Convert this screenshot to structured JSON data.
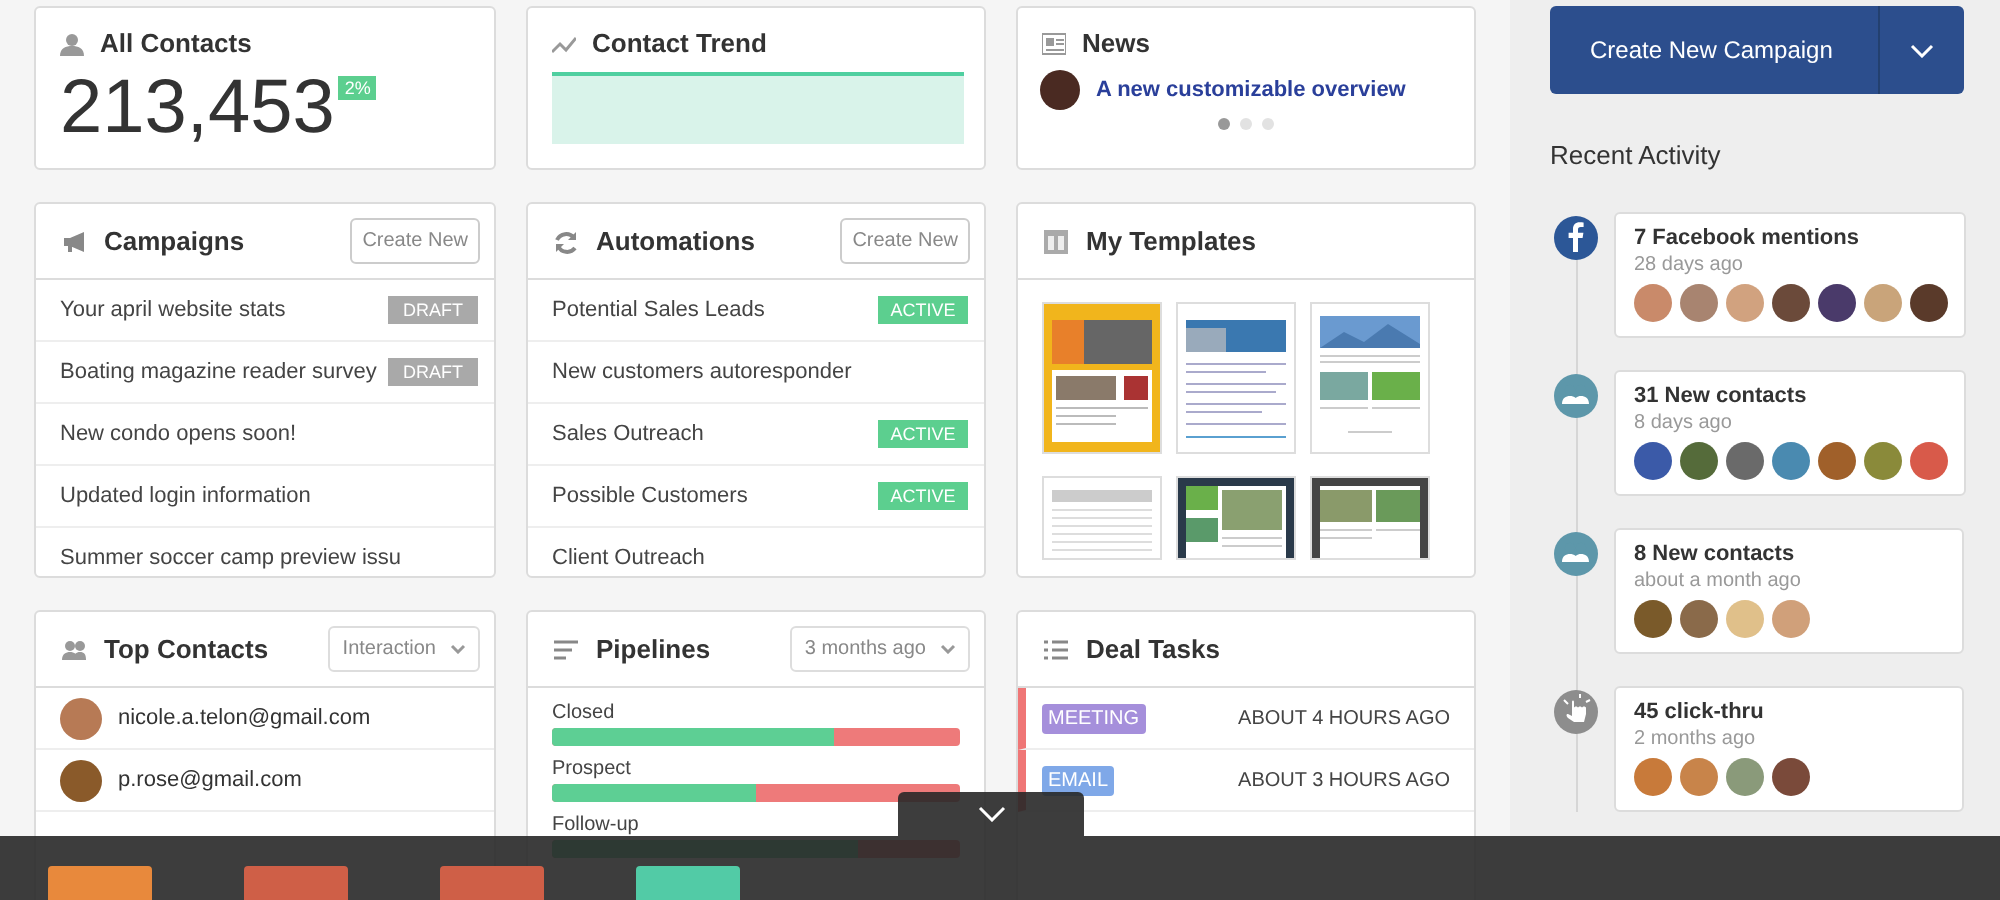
{
  "summary": {
    "title": "All Contacts",
    "count": "213,453",
    "change": "2%"
  },
  "trend": {
    "title": "Contact Trend"
  },
  "news": {
    "title": "News",
    "headline": "A new customizable overview",
    "pages": [
      {
        "selected": true
      },
      {
        "selected": false
      },
      {
        "selected": false
      }
    ]
  },
  "campaigns": {
    "title": "Campaigns",
    "action": "Create New",
    "rows": [
      {
        "name": "Your april website stats",
        "status": "DRAFT"
      },
      {
        "name": "Boating magazine reader survey",
        "status": "DRAFT"
      },
      {
        "name": "New condo opens soon!"
      },
      {
        "name": "Updated login information"
      },
      {
        "name": "Summer soccer camp preview issu"
      }
    ]
  },
  "automations": {
    "title": "Automations",
    "action": "Create New",
    "rows": [
      {
        "name": "Potential Sales Leads",
        "status": "ACTIVE"
      },
      {
        "name": "New customers autoresponder"
      },
      {
        "name": "Sales Outreach",
        "status": "ACTIVE"
      },
      {
        "name": "Possible Customers",
        "status": "ACTIVE"
      },
      {
        "name": "Client Outreach"
      }
    ]
  },
  "templates": {
    "title": "My Templates",
    "items": [
      {
        "kind": "promo"
      },
      {
        "kind": "newsletter"
      },
      {
        "kind": "landscape"
      },
      {
        "kind": "text"
      },
      {
        "kind": "dark"
      },
      {
        "kind": "grey"
      }
    ]
  },
  "top_contacts": {
    "title": "Top Contacts",
    "filter": "Interaction",
    "rows": [
      {
        "email": "nicole.a.telon@gmail.com",
        "color": "#b77a55"
      },
      {
        "email": "p.rose@gmail.com",
        "color": "#8a5a2a"
      }
    ]
  },
  "pipelines": {
    "title": "Pipelines",
    "filter": "3 months ago",
    "stages": [
      {
        "name": "Closed",
        "level": 0.69
      },
      {
        "name": "Prospect",
        "level": 0.5
      },
      {
        "name": "Follow-up",
        "level": 0.75
      }
    ]
  },
  "deal_tasks": {
    "title": "Deal Tasks",
    "rows": [
      {
        "type": "MEETING",
        "color": "#a58fdb",
        "time": "ABOUT 4 HOURS AGO"
      },
      {
        "type": "EMAIL",
        "color": "#7fa8e8",
        "time": "ABOUT 3 HOURS AGO"
      }
    ]
  },
  "sidebar": {
    "primary_button": "Create New Campaign",
    "heading": "Recent Activity",
    "activity": [
      {
        "kind": "facebook",
        "title": "7 Facebook mentions",
        "time": "28 days ago",
        "avatars": [
          {
            "color": "#c98a6a"
          },
          {
            "color": "#a88470"
          },
          {
            "color": "#d1a27f"
          },
          {
            "color": "#6b4a3a"
          },
          {
            "color": "#4a3a6a"
          },
          {
            "color": "#c9a47a"
          },
          {
            "color": "#5a3a2a"
          }
        ]
      },
      {
        "kind": "contacts",
        "title": "31 New contacts",
        "time": "8 days ago",
        "avatars": [
          {
            "color": "#3b5aa8"
          },
          {
            "color": "#556b3a"
          },
          {
            "color": "#6a6a6a"
          },
          {
            "color": "#4a8ab0"
          },
          {
            "color": "#a0602a"
          },
          {
            "color": "#8a8a3a"
          },
          {
            "color": "#d85a4a"
          }
        ]
      },
      {
        "kind": "contacts",
        "title": "8 New contacts",
        "time": "about a month ago",
        "avatars": [
          {
            "color": "#7a5a2a"
          },
          {
            "color": "#8a6a4a"
          },
          {
            "color": "#e0c08a"
          },
          {
            "color": "#d0a07a"
          }
        ]
      },
      {
        "kind": "click",
        "title": "45 click-thru",
        "time": "2 months ago",
        "avatars": [
          {
            "color": "#c87a3a"
          },
          {
            "color": "#c8844a"
          },
          {
            "color": "#8a9a7a"
          },
          {
            "color": "#7a4a3a"
          }
        ]
      }
    ]
  },
  "dock": {
    "tiles": [
      {
        "color": "#e8893c"
      },
      {
        "color": "#cf5f47"
      },
      {
        "color": "#cf5f47"
      },
      {
        "color": "#52cba6"
      }
    ]
  }
}
